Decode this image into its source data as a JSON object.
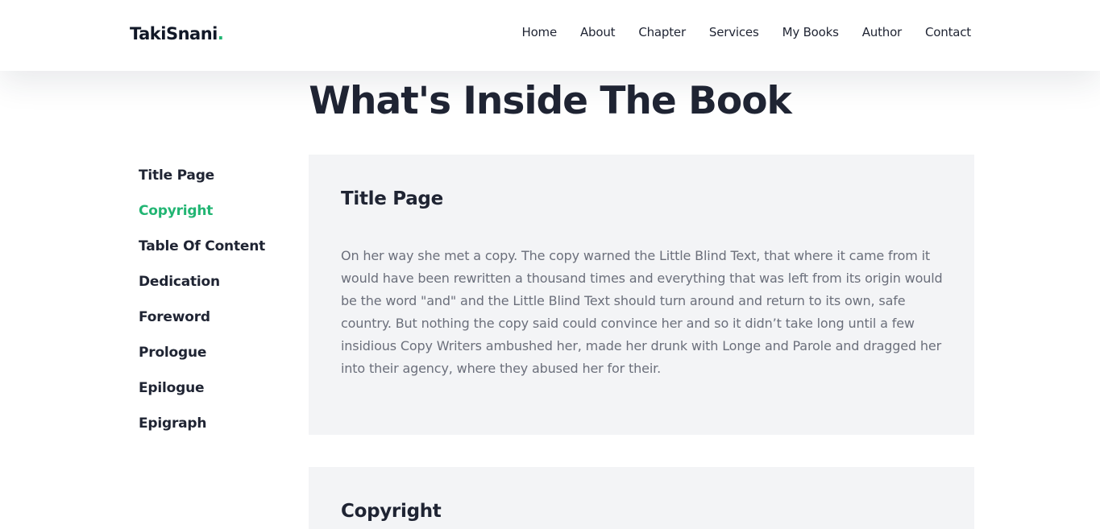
{
  "header": {
    "logo_text": "TakiSnani",
    "logo_dot": ".",
    "nav": [
      "Home",
      "About",
      "Chapter",
      "Services",
      "My Books",
      "Author",
      "Contact"
    ]
  },
  "main": {
    "title": "What's Inside The Book",
    "sidebar_items": [
      "Title Page",
      "Copyright",
      "Table Of Content",
      "Dedication",
      "Foreword",
      "Prologue",
      "Epilogue",
      "Epigraph"
    ],
    "active_item": "Copyright",
    "sections": [
      {
        "heading": "Title Page",
        "body": "On her way she met a copy. The copy warned the Little Blind Text, that where it came from it would have been rewritten a thousand times and everything that was left from its origin would be the word \"and\" and the Little Blind Text should turn around and return to its own, safe country. But nothing the copy said could convince her and so it didn’t take long until a few insidious Copy Writers ambushed her, made her drunk with Longe and Parole and dragged her into their agency, where they abused her for their."
      },
      {
        "heading": "Copyright"
      }
    ]
  },
  "colors": {
    "accent": "#22b573",
    "text": "#1f2433",
    "muted": "#6b6f7b",
    "card_bg": "#f3f4f6"
  }
}
